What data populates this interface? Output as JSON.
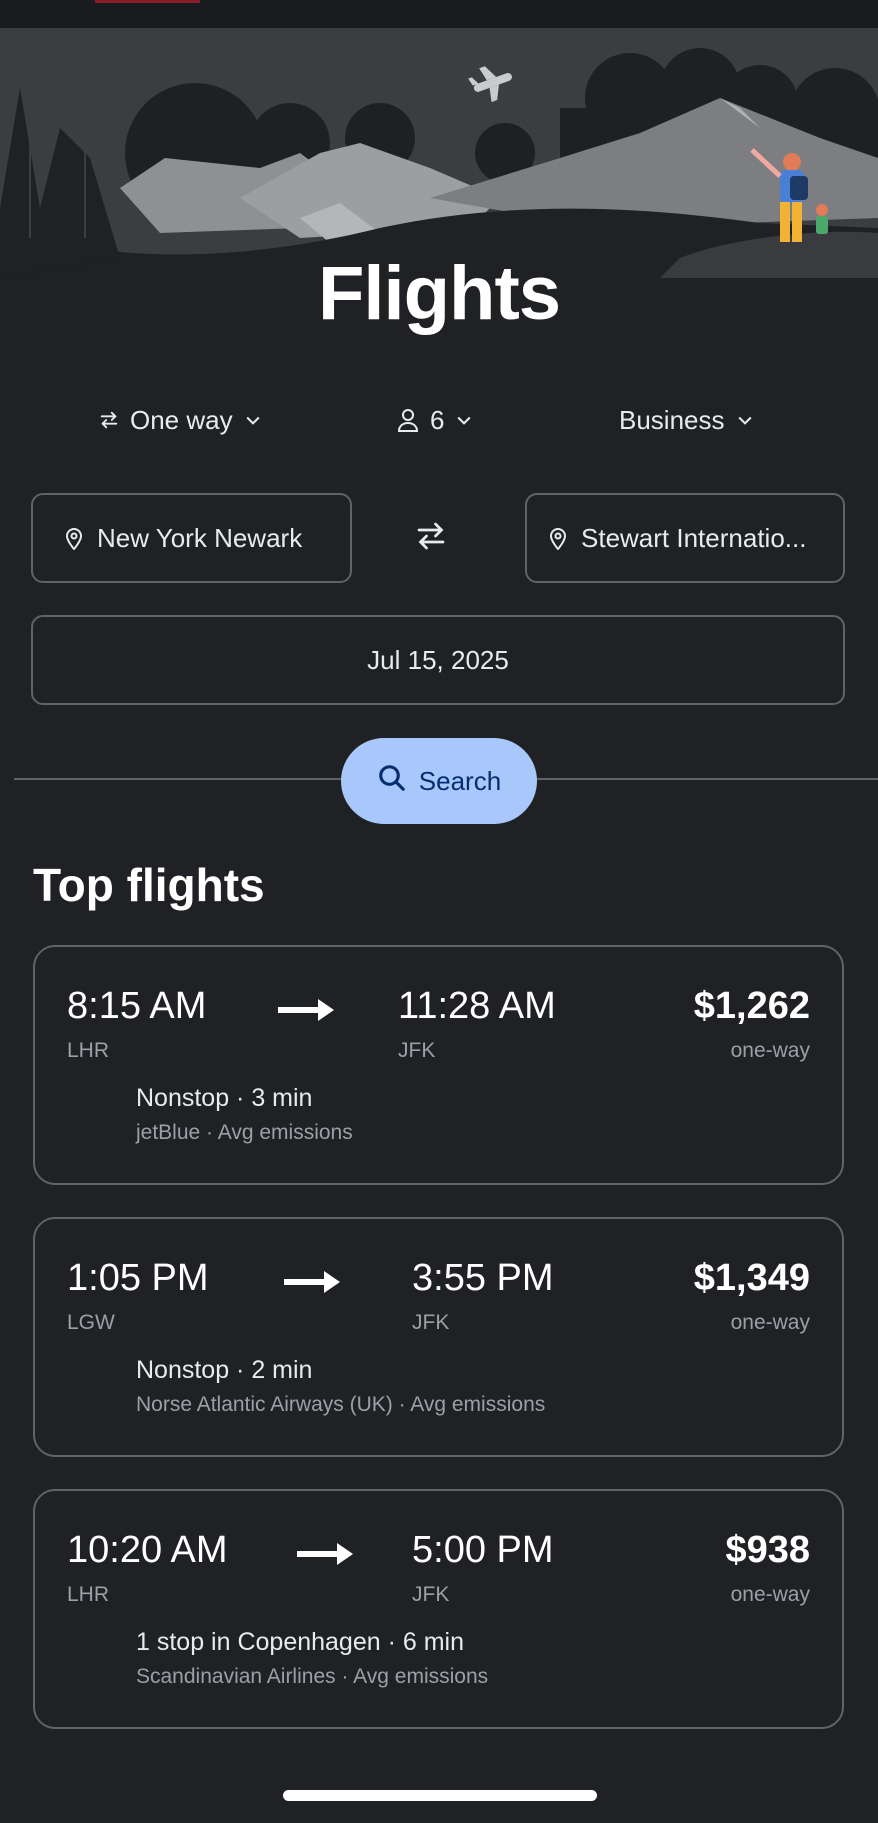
{
  "header": {
    "title": "Flights"
  },
  "options": {
    "trip_type": "One way",
    "passengers": "6",
    "cabin_class": "Business"
  },
  "route": {
    "origin": "New York Newark",
    "destination": "Stewart Internatio..."
  },
  "date": "Jul 15, 2025",
  "search": {
    "label": "Search"
  },
  "top_flights": {
    "title": "Top flights",
    "items": [
      {
        "depart": "8:15 AM",
        "arrive": "11:28 AM",
        "from": "LHR",
        "to": "JFK",
        "price": "$1,262",
        "price_type": "one-way",
        "stops": "Nonstop · 3 min",
        "airline": "jetBlue · Avg emissions"
      },
      {
        "depart": "1:05 PM",
        "arrive": "3:55 PM",
        "from": "LGW",
        "to": "JFK",
        "price": "$1,349",
        "price_type": "one-way",
        "stops": "Nonstop · 2 min",
        "airline": "Norse Atlantic Airways (UK) · Avg emissions"
      },
      {
        "depart": "10:20 AM",
        "arrive": "5:00 PM",
        "from": "LHR",
        "to": "JFK",
        "price": "$938",
        "price_type": "one-way",
        "stops": "1 stop in Copenhagen · 6 min",
        "airline": "Scandinavian Airlines · Avg emissions"
      }
    ]
  },
  "colors": {
    "background": "#202124",
    "accent": "#a8c7fa",
    "border": "#5f6368"
  },
  "icons": [
    "swap-icon",
    "person-icon",
    "chevron-down-icon",
    "location-pin-icon",
    "search-icon",
    "arrow-right-icon",
    "airplane-icon"
  ]
}
